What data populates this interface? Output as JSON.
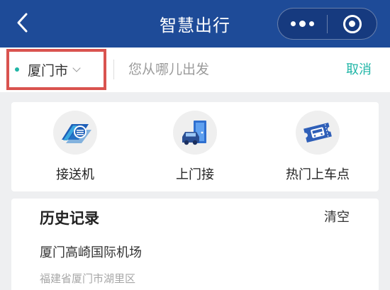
{
  "header": {
    "title": "智慧出行",
    "background_color": "#1e4b98",
    "back_icon": "chevron-left-icon",
    "more_icon": "more-dots-icon",
    "close_icon": "target-circle-icon"
  },
  "search": {
    "city": "厦门市",
    "placeholder": "您从哪儿出发",
    "value": "",
    "cancel_label": "取消",
    "accent_color": "#1fb5a6",
    "highlight_color": "#d9534f"
  },
  "services": [
    {
      "label": "接送机",
      "icon": "airport-transfer-icon"
    },
    {
      "label": "上门接",
      "icon": "door-pickup-icon"
    },
    {
      "label": "热门上车点",
      "icon": "bus-ticket-icon"
    }
  ],
  "history": {
    "title": "历史记录",
    "clear_label": "清空",
    "items": [
      {
        "name": "厦门高崎国际机场",
        "address": "福建省厦门市湖里区"
      }
    ]
  }
}
